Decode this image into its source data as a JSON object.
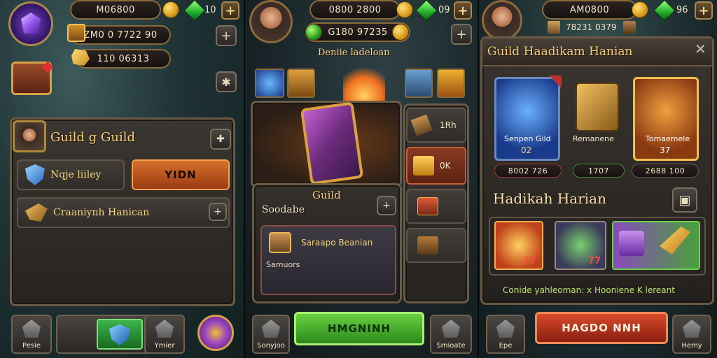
{
  "screen1": {
    "top_currency": "M06800",
    "gem_count": "10",
    "gold_bar": "ZM0 0 7722 90",
    "resource_bar": "110 06313",
    "guild_title": "Guild g Guild",
    "row1_label": "Nqje liiley",
    "row1_button": "YIDN",
    "row2_label": "Craaniynh Hanican",
    "nav_left": "Pesie",
    "nav_right": "Ymier"
  },
  "screen2": {
    "top_currency": "0800 2800",
    "gem_count": "09",
    "gold_bar": "G180 97235",
    "event_title": "Deniie ladeloan",
    "panel_title": "Guild",
    "panel_subtitle": "Soodabe",
    "inner_label": "Saraapo Beanian",
    "inner_sub": "Samuors",
    "side_label_1": "1Rh",
    "side_label_2": "0K",
    "big_button": "HMGNINH",
    "nav_left": "Sonyjoo",
    "nav_right": "Smioate"
  },
  "screen3": {
    "top_currency": "AM0800",
    "gem_count": "96",
    "sub_currency": "78231 0379",
    "dialog_title": "Guild Haadikam Hanian",
    "card1_label": "Senpen Gild",
    "card1_num": "02",
    "card2_label": "Remanene",
    "card3_label": "Tomaemele",
    "card3_num": "37",
    "stat1": "8002 726",
    "stat2": "1707",
    "stat3": "2688 100",
    "section_title": "Hadikah Harian",
    "reward_num_1": "77",
    "reward_num_2": "77",
    "footer_text": "Conide yahleoman: x Hooniene K lereant",
    "big_button": "HAGDO NNH",
    "nav_left": "Epe",
    "nav_right": "Hemy"
  },
  "colors": {
    "gold_text": "#f0d27a",
    "green_button": "#3fa83a",
    "red_button": "#b8341f",
    "orange_button": "#c3551d"
  },
  "icons": [
    "gem-icon",
    "coin-icon",
    "chest-icon",
    "plus-icon",
    "close-icon",
    "shield-icon",
    "sword-icon",
    "home-icon"
  ]
}
